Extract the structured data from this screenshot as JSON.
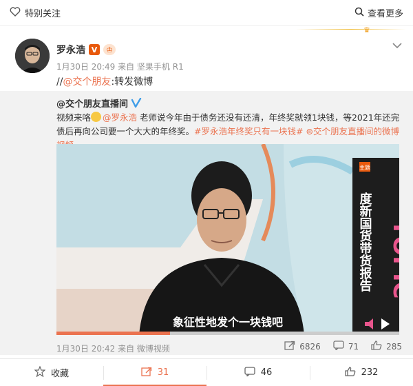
{
  "topbar": {
    "follow_label": "特别关注",
    "see_more_label": "查看更多"
  },
  "post": {
    "author": "罗永浩",
    "meta": "1月30日 20:49 来自 坚果手机 R1",
    "repost_prefix": "//",
    "repost_mention": "@交个朋友",
    "repost_suffix": ":转发微博"
  },
  "original": {
    "user": "@交个朋友直播间",
    "text_pre": "视频来咯",
    "mention": "@罗永浩",
    "text_mid": " 老师说今年由于债务还没有还清，年终奖就领1块钱，等2021年还完债后再向公司要一个大大的年终奖。",
    "hashtag": "#罗永浩年终奖只有一块钱#",
    "video_link": "交个朋友直播间的微博视频",
    "video": {
      "subtitle": "象征性地发个一块钱吧",
      "banner_label": "主题",
      "banner_text": "度新国货带货报告",
      "topic_text": "TOPIC"
    },
    "meta": "1月30日 20:42 来自 微博视频",
    "stats": {
      "reposts": "6826",
      "comments": "71",
      "likes": "285"
    }
  },
  "actions": {
    "collect": "收藏",
    "repost": "31",
    "comment": "46",
    "like": "232"
  },
  "colors": {
    "accent": "#eb7350",
    "verified_blue": "#3f9de8",
    "verified_orange": "#e8590c"
  }
}
